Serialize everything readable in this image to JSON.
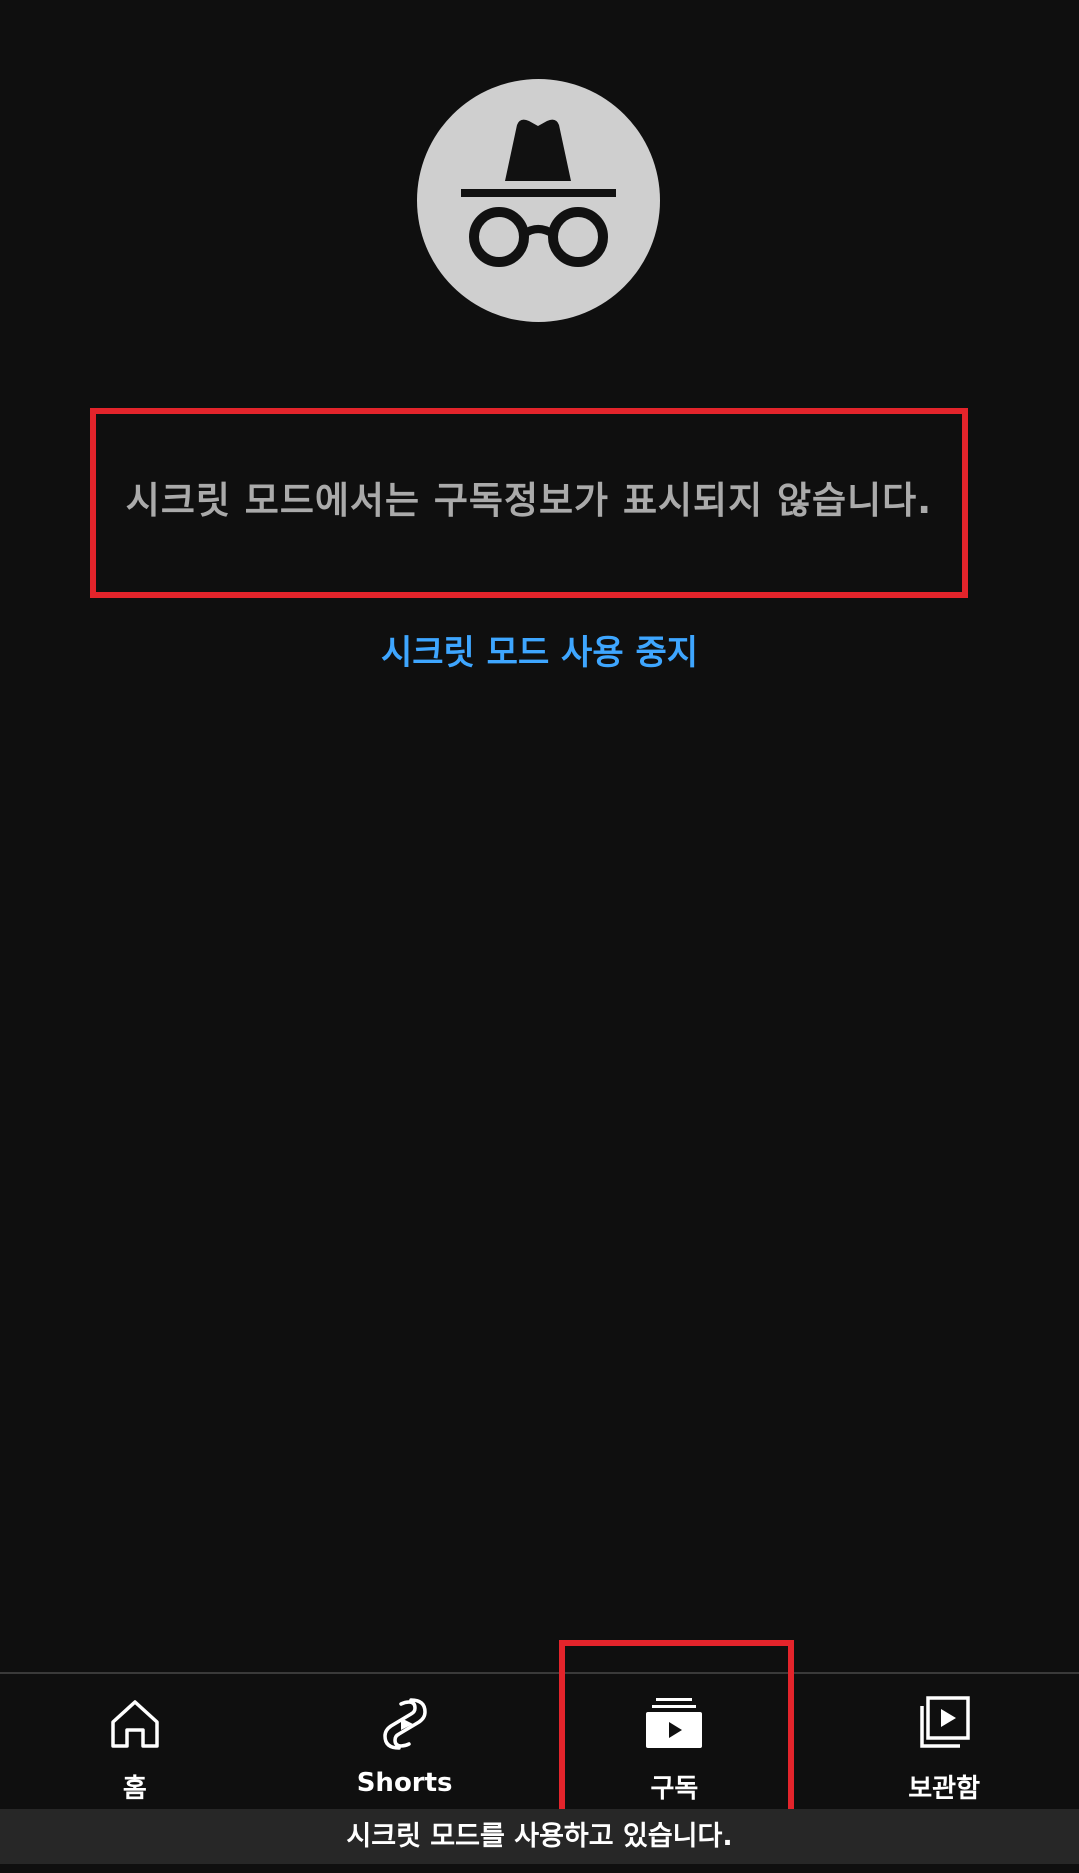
{
  "message": "시크릿 모드에서는 구독정보가 표시되지 않습니다.",
  "stop_incognito_link": "시크릿 모드 사용 중지",
  "nav": {
    "home": "홈",
    "shorts": "Shorts",
    "subscriptions": "구독",
    "library": "보관함"
  },
  "status_bar": "시크릿 모드를 사용하고 있습니다.",
  "colors": {
    "background": "#0f0f0f",
    "link": "#3ea6ff",
    "highlight": "#e3242b"
  }
}
